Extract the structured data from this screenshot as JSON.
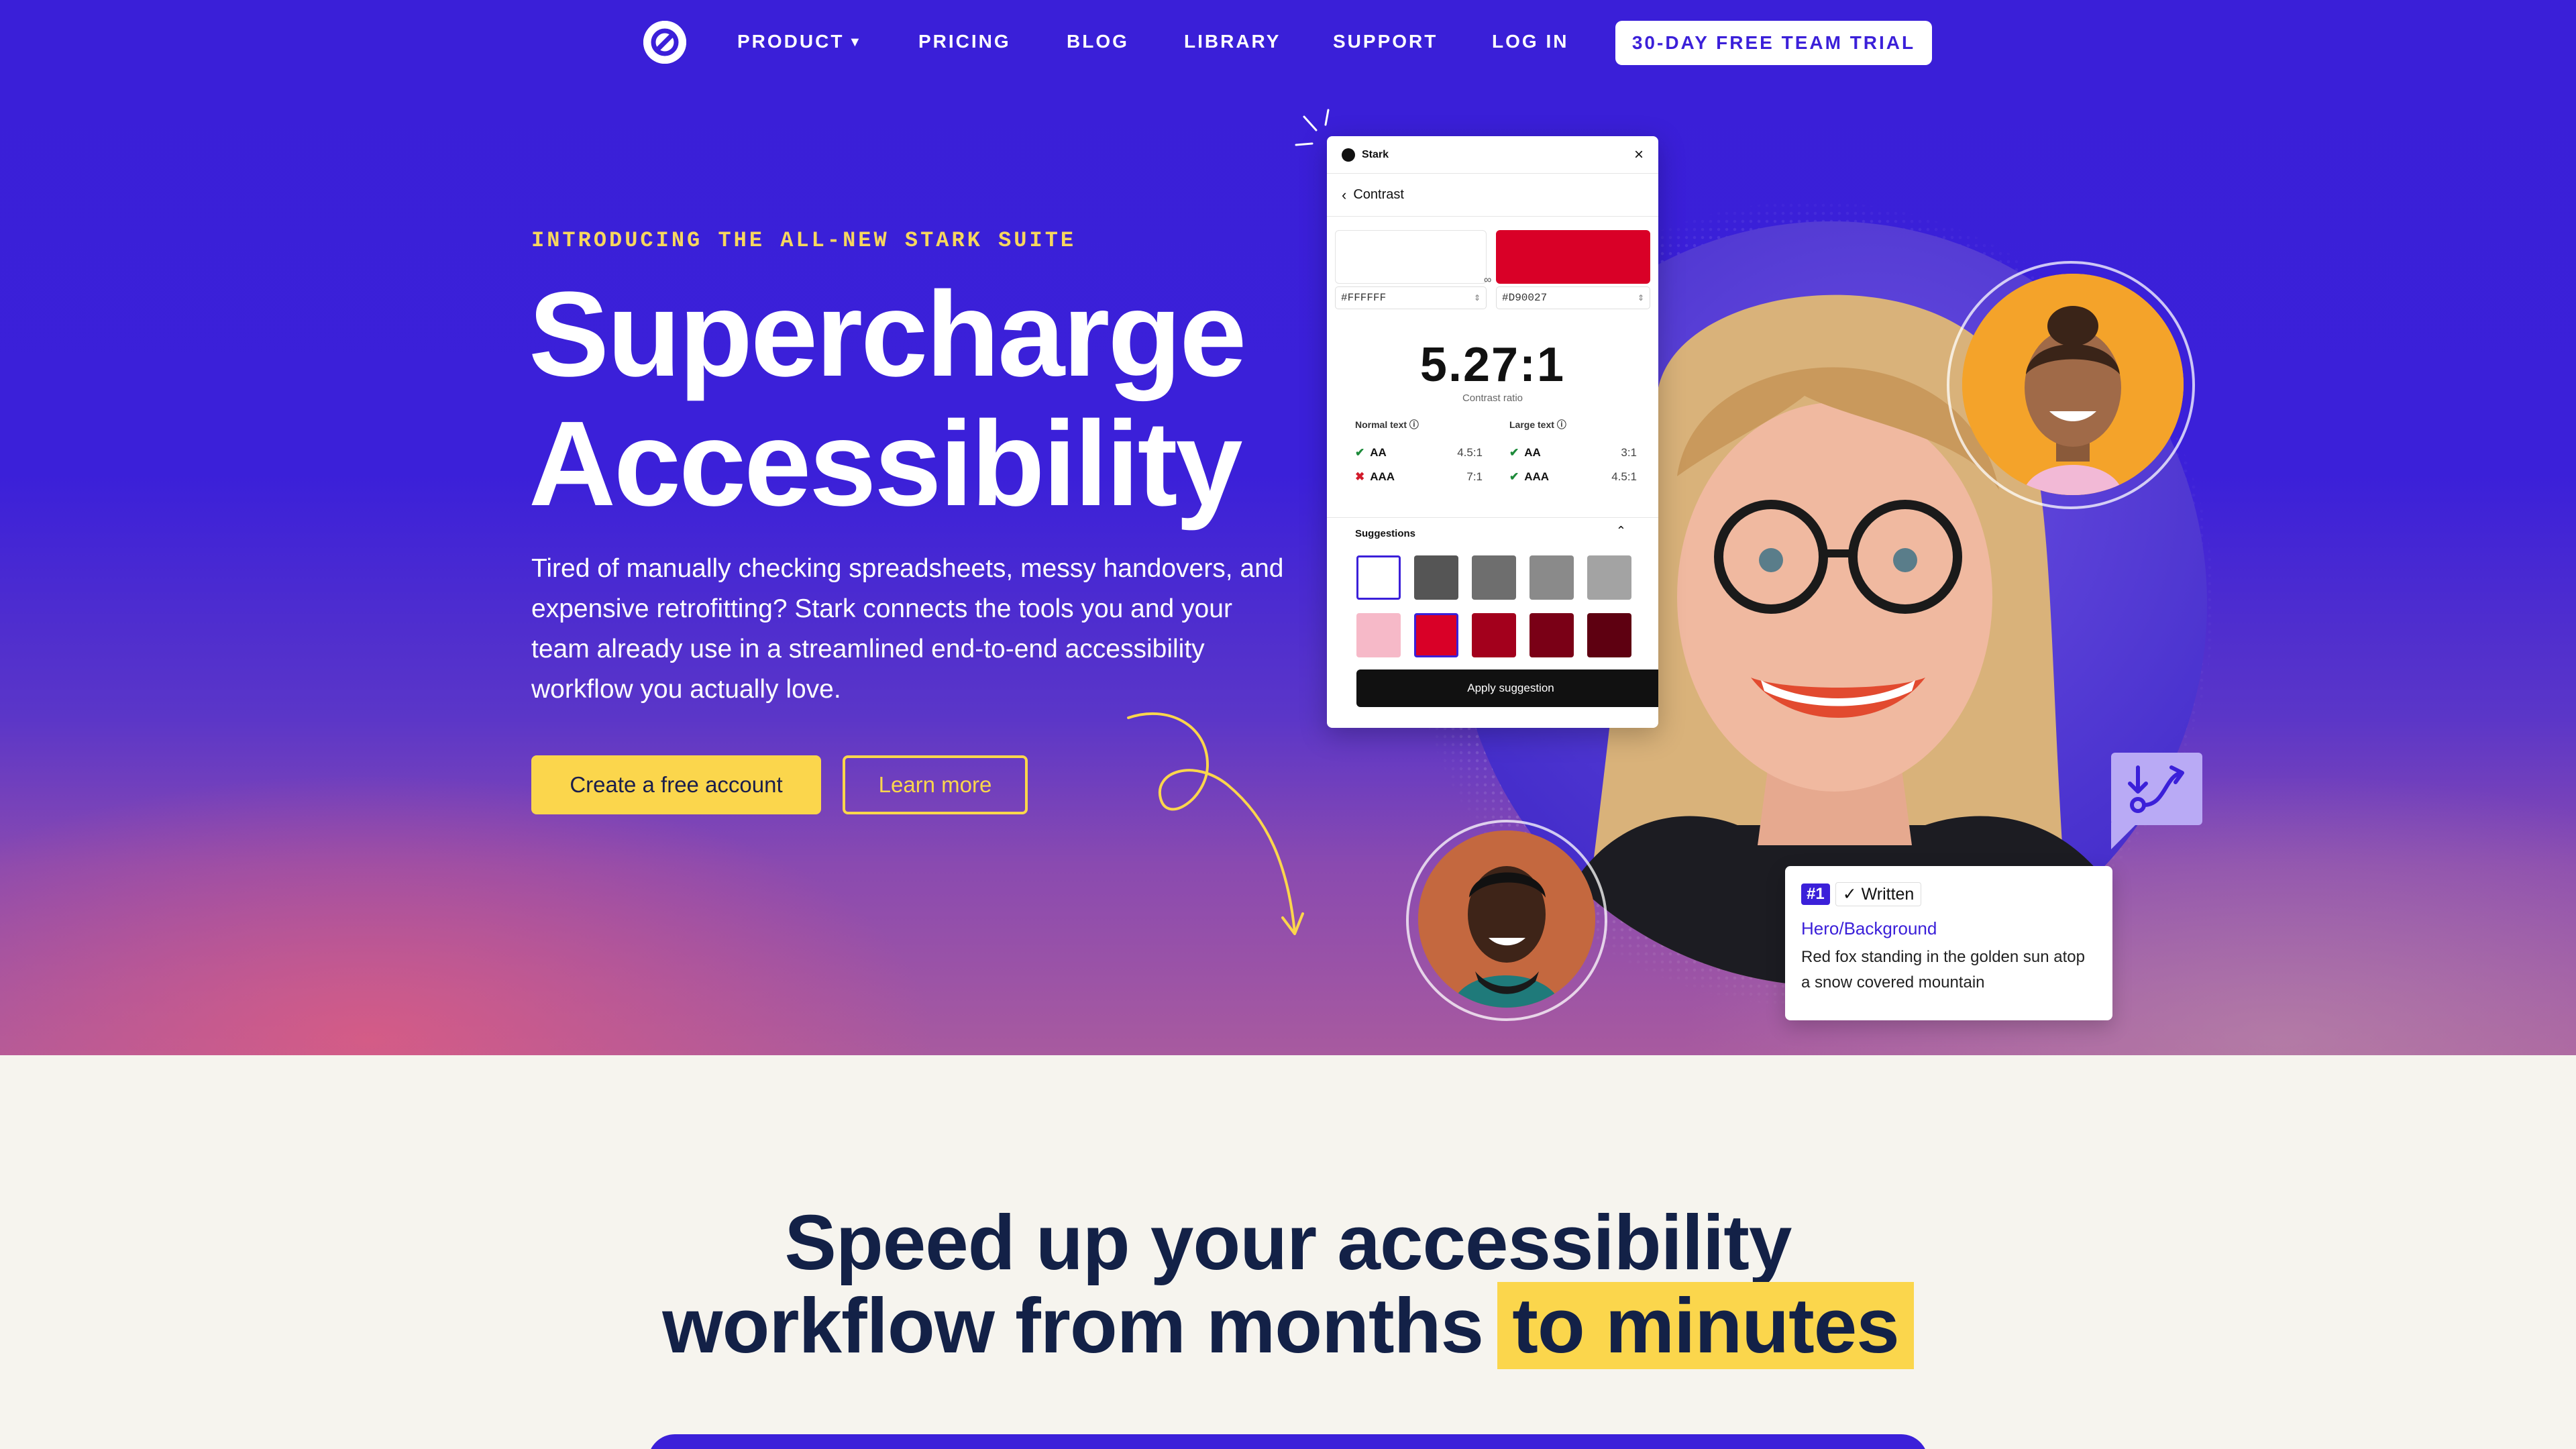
{
  "nav": {
    "logo_icon": "stark-logo-icon",
    "items": [
      {
        "label": "PRODUCT",
        "has_dropdown": true
      },
      {
        "label": "PRICING"
      },
      {
        "label": "BLOG"
      },
      {
        "label": "LIBRARY"
      },
      {
        "label": "SUPPORT"
      },
      {
        "label": "LOG IN"
      }
    ],
    "cta": "30-DAY FREE TEAM TRIAL"
  },
  "hero": {
    "eyebrow": "INTRODUCING THE ALL-NEW STARK SUITE",
    "title_line1": "Supercharge",
    "title_line2": "Accessibility",
    "description": "Tired of manually checking spreadsheets, messy handovers, and expensive retrofitting? Stark connects the tools you and your team already use in a streamlined end-to-end accessibility workflow you actually love.",
    "primary_button": "Create a free account",
    "secondary_button": "Learn more"
  },
  "contrast_panel": {
    "app_name": "Stark",
    "section": "Contrast",
    "foreground_hex": "#FFFFFF",
    "background_hex": "#D90027",
    "ratio": "5.27:1",
    "ratio_caption": "Contrast ratio",
    "normal_text": {
      "label": "Normal text",
      "rows": [
        {
          "level": "AA",
          "value": "4.5:1",
          "pass": true
        },
        {
          "level": "AAA",
          "value": "7:1",
          "pass": false
        }
      ]
    },
    "large_text": {
      "label": "Large text",
      "rows": [
        {
          "level": "AA",
          "value": "3:1",
          "pass": true
        },
        {
          "level": "AAA",
          "value": "4.5:1",
          "pass": true
        }
      ]
    },
    "suggestions_label": "Suggestions",
    "suggestion_colors_row1": [
      "#ffffff",
      "#555555",
      "#6e6e6e",
      "#8a8a8a",
      "#a3a3a3"
    ],
    "suggestion_colors_row2": [
      "#f6b9c8",
      "#d90027",
      "#a3001c",
      "#7a0016",
      "#5e0011"
    ],
    "apply_button": "Apply suggestion"
  },
  "alt_card": {
    "number": "#1",
    "state": "Written",
    "path": "Hero/Background",
    "text": "Red fox standing in the golden sun atop a snow covered mountain"
  },
  "section2": {
    "title_line1": "Speed up your accessibility",
    "title_line2_a": "workflow from months",
    "title_line2_highlight": "to minutes"
  },
  "colors": {
    "brand_purple": "#3b20d9",
    "accent_yellow": "#fbd64c",
    "navy": "#132147",
    "fail_red": "#d21b2b",
    "pass_green": "#1d8a3a"
  }
}
